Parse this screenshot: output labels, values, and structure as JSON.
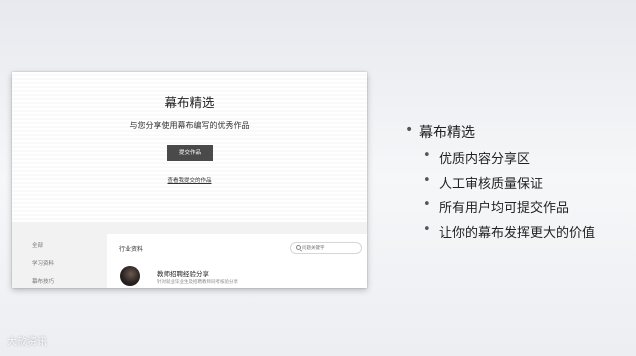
{
  "screenshot": {
    "hero": {
      "title": "幕布精选",
      "subtitle": "与您分享使用幕布编写的优秀作品",
      "submit_button": "提交作品",
      "view_link": "查看我提交的作品"
    },
    "sidebar": {
      "items": [
        {
          "label": "全部"
        },
        {
          "label": "学习资料"
        },
        {
          "label": "幕布技巧"
        }
      ]
    },
    "content": {
      "category_title": "行业资料",
      "search_placeholder": "问题关键字",
      "items": [
        {
          "title": "教师招聘经验分享",
          "description": "针对就业毕业生及招聘教师同考核验分享"
        }
      ]
    }
  },
  "bullets": {
    "main": "幕布精选",
    "sub": [
      "优质内容分享区",
      "人工审核质量保证",
      "所有用户均可提交作品",
      "让你的幕布发挥更大的价值"
    ]
  },
  "watermark": "大款资讯"
}
